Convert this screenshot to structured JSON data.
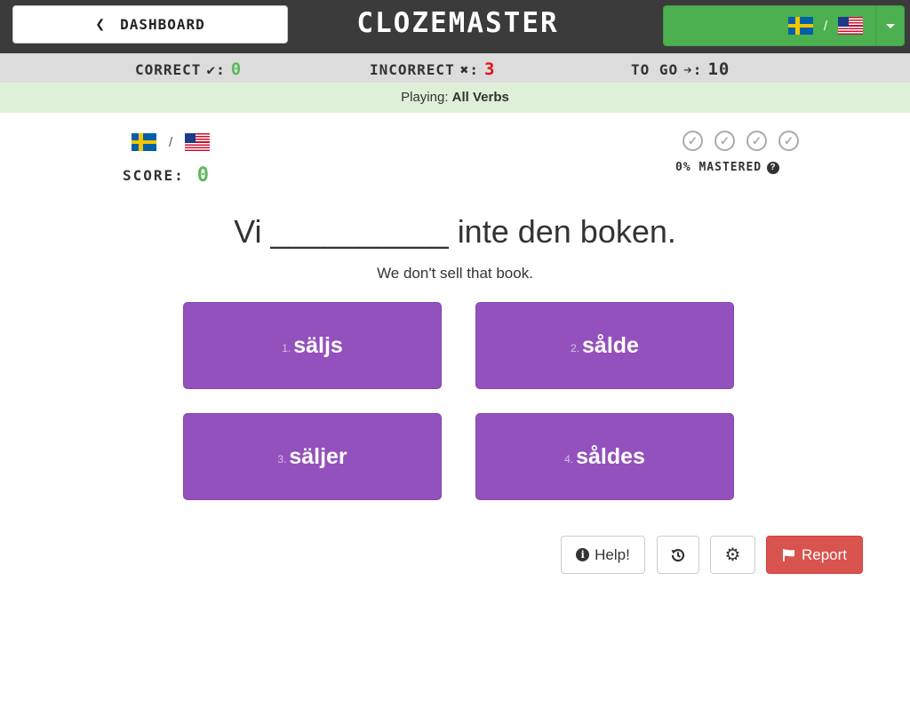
{
  "header": {
    "dashboard_label": "DASHBOARD",
    "brand": "CLOZEMASTER",
    "language_pair": {
      "from": "Swedish",
      "to": "English",
      "separator": "/"
    }
  },
  "stats": {
    "correct_label": "CORRECT",
    "correct_value": "0",
    "incorrect_label": "INCORRECT",
    "incorrect_value": "3",
    "togo_label": "TO GO",
    "togo_value": "10"
  },
  "playing": {
    "prefix": "Playing:",
    "collection": "All Verbs"
  },
  "score": {
    "label": "SCORE:",
    "value": "0"
  },
  "mastery": {
    "label": "0% MASTERED"
  },
  "question": {
    "sentence": "Vi __________ inte den boken.",
    "translation": "We don't sell that book."
  },
  "options": [
    {
      "index": "1.",
      "word": "säljs"
    },
    {
      "index": "2.",
      "word": "sålde"
    },
    {
      "index": "3.",
      "word": "säljer"
    },
    {
      "index": "4.",
      "word": "såldes"
    }
  ],
  "actions": {
    "help_label": "Help!",
    "report_label": "Report"
  },
  "colors": {
    "topbar": "#3b3b3b",
    "language_button": "#4caf50",
    "option": "#9351bd",
    "report": "#d9534f",
    "correct": "#5cb85c",
    "incorrect": "#e8101a"
  }
}
